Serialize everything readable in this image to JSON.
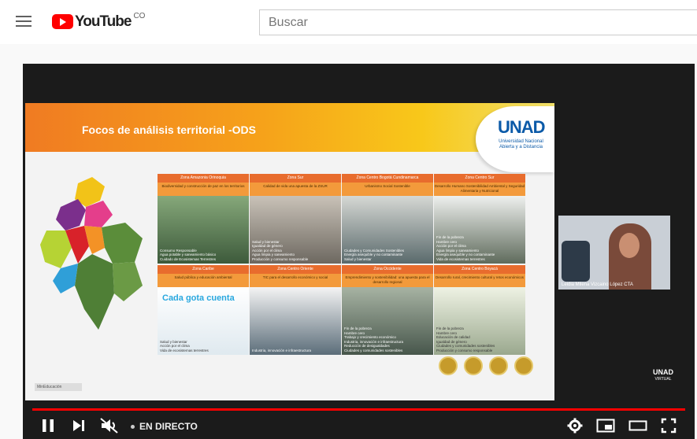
{
  "masthead": {
    "logo_text": "YouTube",
    "country_code": "CO",
    "search_placeholder": "Buscar"
  },
  "slide": {
    "title": "Focos de análisis territorial -ODS",
    "logo_name": "UNAD",
    "logo_subtitle": "Universidad Nacional Abierta y a Distancia",
    "footer_logo": "MinEducación",
    "zones": [
      {
        "name": "Zona Amazonia Orinoquia",
        "desc": "Biodiversidad y construcción de paz en los territorios",
        "items": [
          "Consumo Responsable",
          "Agua potable y saneamiento básico",
          "Cuidado de Ecosistemas Terrestres"
        ]
      },
      {
        "name": "Zona Sur",
        "desc": "Calidad de vida una apuesta de la ZSUR",
        "items": [
          "Salud y bienestar",
          "Igualdad de género",
          "Acción por el clima",
          "Agua limpia y saneamiento",
          "Producción y consumo responsable"
        ]
      },
      {
        "name": "Zona Centro Bogotá Cundinamarca",
        "desc": "Urbanismo Social Sostenible",
        "items": [
          "Ciudades y Comunidades Sostenibles",
          "Energía asequible y no contaminante",
          "Salud y bienestar"
        ]
      },
      {
        "name": "Zona Centro Sur",
        "desc": "Desarrollo Humano Sostenibilidad Ambiental y Seguridad Alimentaria y Nutricional",
        "items": [
          "Fin de la pobreza",
          "Hambre cero",
          "Acción por el clima",
          "Agua limpia y saneamiento",
          "Energía asequible y no contaminante",
          "Vida de ecosistemas terrestres"
        ]
      },
      {
        "name": "Zona Caribe",
        "desc": "Salud pública y educación ambiental",
        "items": [
          "Salud y bienestar",
          "Acción por el clima",
          "Vida de ecosistemas terrestres"
        ],
        "poster": "Cada gota cuenta"
      },
      {
        "name": "Zona Centro Oriente",
        "desc": "TIC para el desarrollo económico y social",
        "items": [
          "Industria, innovación e infraestructura"
        ]
      },
      {
        "name": "Zona Occidente",
        "desc": "Emprendimiento y sostenibilidad: una apuesta para el desarrollo regional",
        "items": [
          "Fin de la pobreza",
          "Hambre cero",
          "Trabajo y crecimiento económico",
          "Industria, innovación e infraestructura",
          "Reducción de desigualdades",
          "Ciudades y comunidades sostenibles"
        ]
      },
      {
        "name": "Zona Centro Boyacá",
        "desc": "Desarrollo rural, crecimiento cultural y retos económicos",
        "items": [
          "Fin de la pobreza",
          "Hambre cero",
          "Educación de calidad",
          "Igualdad de género",
          "Ciudades y comunidades sostenibles",
          "Producción y consumo responsable"
        ]
      }
    ]
  },
  "pip": {
    "participant_name": "Leidia Milena Vizcaino López CTA"
  },
  "watermark": {
    "name": "UNAD",
    "sub": "VIRTUAL"
  },
  "controls": {
    "live_label": "EN DIRECTO"
  },
  "colors": {
    "accent": "#ff0000",
    "header_orange": "#f07b22",
    "unad_blue": "#0b5aa8"
  }
}
